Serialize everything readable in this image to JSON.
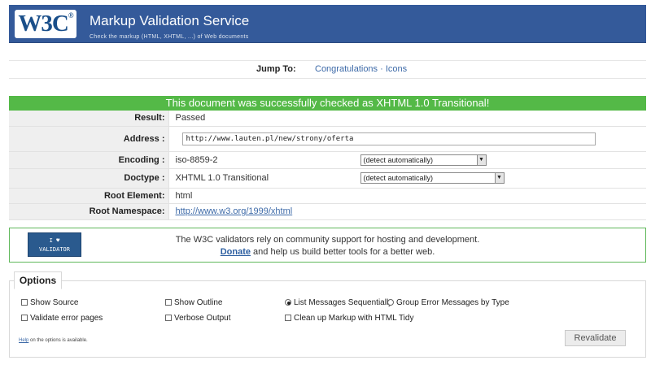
{
  "banner": {
    "logo_text": "W3C",
    "logo_mark": "®",
    "title": "Markup Validation Service",
    "subtitle": "Check the markup (HTML, XHTML, ...) of Web documents",
    "color": "#345a9a"
  },
  "jump": {
    "label": "Jump To:",
    "links": [
      "Congratulations",
      "Icons"
    ],
    "separator": "·"
  },
  "result_banner": {
    "text": "This document was successfully checked as XHTML 1.0 Transitional!",
    "color": "#54b947"
  },
  "results": {
    "result_label": "Result:",
    "result_value": "Passed",
    "address_label": "Address :",
    "address_value": "http://www.lauten.pl/new/strony/oferta",
    "encoding_label": "Encoding :",
    "encoding_value": "iso-8859-2",
    "encoding_select": "(detect automatically)",
    "doctype_label": "Doctype :",
    "doctype_value": "XHTML 1.0 Transitional",
    "doctype_select": "(detect automatically)",
    "root_element_label": "Root Element:",
    "root_element_value": "html",
    "root_namespace_label": "Root Namespace:",
    "root_namespace_value": "http://www.w3.org/1999/xhtml"
  },
  "donate": {
    "badge_line1": "I ♥",
    "badge_line2": "VALIDATOR",
    "line1": "The W3C validators rely on community support for hosting and development.",
    "link": "Donate",
    "line2_rest": " and help us build better tools for a better web."
  },
  "options": {
    "legend": "Options",
    "show_source": "Show Source",
    "show_outline": "Show Outline",
    "list_sequential": "List Messages Sequentially",
    "group_by_type": "Group Error Messages by Type",
    "validate_error_pages": "Validate error pages",
    "verbose_output": "Verbose Output",
    "cleanup_tidy": "Clean up Markup with HTML Tidy",
    "help_link": "Help",
    "help_rest": " on the options is available.",
    "revalidate": "Revalidate"
  }
}
